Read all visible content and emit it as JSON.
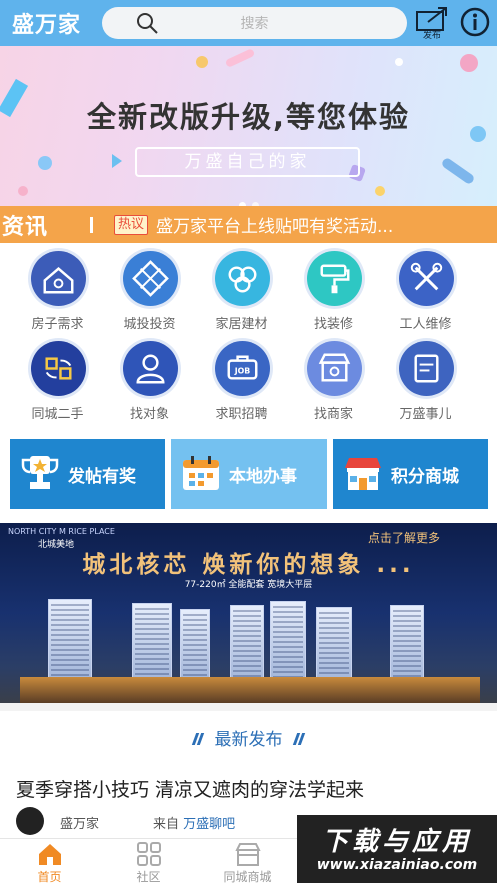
{
  "header": {
    "logo": "盛万家",
    "search_placeholder": "搜索",
    "publish_label": "发布"
  },
  "banner": {
    "headline": "全新改版升级,等您体验",
    "subline": "万盛自己的家"
  },
  "ticker": {
    "section": "资讯",
    "tag": "热议",
    "text": "盛万家平台上线贴吧有奖活动..."
  },
  "grid": [
    {
      "label": "房子需求",
      "color": "#3c5cb8"
    },
    {
      "label": "城投投资",
      "color": "#3a7fd6"
    },
    {
      "label": "家居建材",
      "color": "#37b6e0"
    },
    {
      "label": "找装修",
      "color": "#2ec7c3"
    },
    {
      "label": "工人维修",
      "color": "#3c63c6"
    },
    {
      "label": "同城二手",
      "color": "#233f9e"
    },
    {
      "label": "找对象",
      "color": "#2f55b8"
    },
    {
      "label": "求职招聘",
      "color": "#3a66c4"
    },
    {
      "label": "找商家",
      "color": "#6c8be0"
    },
    {
      "label": "万盛事儿",
      "color": "#3e64c0"
    }
  ],
  "cards": [
    {
      "label": "发帖有奖"
    },
    {
      "label": "本地办事"
    },
    {
      "label": "积分商城"
    }
  ],
  "ad": {
    "brand": "NORTH CITY M RICE PLACE",
    "brand_cn": "北城美地",
    "cta": "点击了解更多",
    "headline": "城北核芯  焕新你的想象 ...",
    "detail": "77-220㎡ 全能配套 宽境大平层"
  },
  "latest": {
    "title": "最新发布"
  },
  "post": {
    "title": "夏季穿搭小技巧 清凉又遮肉的穿法学起来",
    "author": "盛万家",
    "from_prefix": "来自",
    "from_source": "万盛聊吧"
  },
  "tabs": [
    {
      "label": "首页",
      "active": true
    },
    {
      "label": "社区",
      "active": false
    },
    {
      "label": "同城商城",
      "active": false
    },
    {
      "label": "",
      "active": false
    },
    {
      "label": "",
      "active": false
    }
  ],
  "watermark": {
    "line1": "下载与应用",
    "line2": "www.xiazainiao.com"
  }
}
